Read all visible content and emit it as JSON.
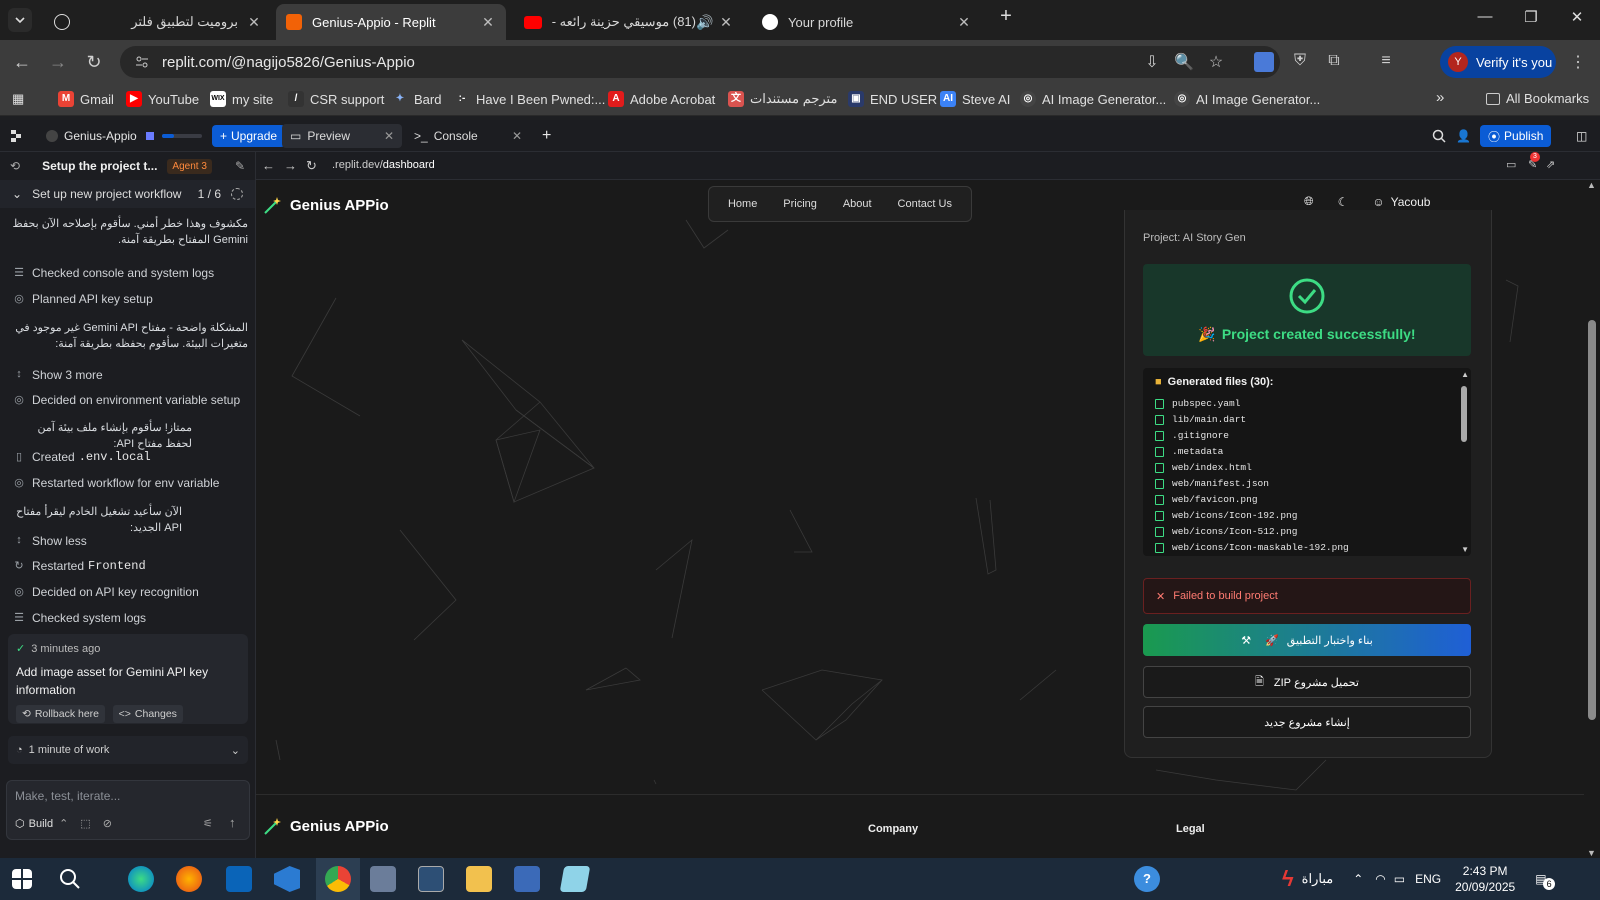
{
  "browser": {
    "tabs": [
      {
        "title": "بروميت لتطبيق فلتر",
        "icon": "openai-icon"
      },
      {
        "title": "Genius-Appio - Replit",
        "icon": "replit-icon"
      },
      {
        "title": "(81) موسيقي حزينة رائعه - e",
        "icon": "youtube-icon"
      },
      {
        "title": "Your profile",
        "icon": "github-icon"
      }
    ],
    "new_tab": "+",
    "url": "replit.com/@nagijo5826/Genius-Appio",
    "verify_label": "Verify it's you",
    "verify_avatar": "Y",
    "window_controls": [
      "—",
      "❐",
      "✕"
    ]
  },
  "bookmarks": {
    "items": [
      "Gmail",
      "YouTube",
      "my site",
      "CSR support",
      "Bard",
      "Have I Been Pwned:...",
      "Adobe Acrobat",
      "مترجم مستندات",
      "END USER",
      "Steve AI",
      "AI Image Generator...",
      "AI Image Generator..."
    ],
    "overflow": "»",
    "all": "All Bookmarks"
  },
  "replit": {
    "project_name": "Genius-Appio",
    "upgrade": "Upgrade",
    "tabs": [
      "Preview",
      "Console"
    ],
    "publish": "Publish"
  },
  "agent": {
    "title": "Setup the project t...",
    "badge": "Agent 3",
    "workflow": "Set up new project workflow",
    "progress": "1 / 6",
    "feed": [
      {
        "type": "ar",
        "text": "مكشوف وهذا خطر أمني. سأقوم بإصلاحه الآن بحفظ Gemini المفتاح بطريقة آمنة."
      },
      {
        "type": "item",
        "text": "Checked console and system logs"
      },
      {
        "type": "item",
        "text": "Planned API key setup"
      },
      {
        "type": "ar",
        "text": "المشكلة واضحة - مفتاح Gemini API غير موجود في متغيرات البيئة. سأقوم بحفظه بطريقة آمنة:"
      },
      {
        "type": "item",
        "text": "Show 3 more"
      },
      {
        "type": "item",
        "text": "Decided on environment variable setup"
      },
      {
        "type": "ar",
        "text": "ممتاز! سأقوم بإنشاء ملف بيئة آمن لحفظ مفتاح API:"
      },
      {
        "type": "item",
        "text": "Created",
        "code": ".env.local"
      },
      {
        "type": "item",
        "text": "Restarted workflow for env variable"
      },
      {
        "type": "ar",
        "text": "الآن سأعيد تشغيل الخادم ليقرأ مفتاح API الجديد:"
      },
      {
        "type": "item",
        "text": "Show less"
      },
      {
        "type": "item",
        "text": "Restarted",
        "code": "Frontend"
      },
      {
        "type": "item",
        "text": "Decided on API key recognition"
      },
      {
        "type": "item",
        "text": "Checked system logs"
      }
    ],
    "card": {
      "time": "3 minutes ago",
      "message": "Add image asset for Gemini API key information",
      "rollback": "Rollback here",
      "changes": "Changes"
    },
    "work": "1 minute of work",
    "input_placeholder": "Make, test, iterate...",
    "build": "Build"
  },
  "preview": {
    "url_prefix": ".replit.dev/",
    "url_path": "dashboard",
    "brand": "Genius APPio",
    "nav": [
      "Home",
      "Pricing",
      "About",
      "Contact Us"
    ],
    "user": "Yacoub",
    "project_label": "Project: AI Story Gen",
    "success": "Project created successfully!",
    "success_emoji": "🎉",
    "files_header": "Generated files (30):",
    "files": [
      "pubspec.yaml",
      "lib/main.dart",
      ".gitignore",
      ".metadata",
      "web/index.html",
      "web/manifest.json",
      "web/favicon.png",
      "web/icons/Icon-192.png",
      "web/icons/Icon-512.png",
      "web/icons/Icon-maskable-192.png"
    ],
    "error": "Failed to build project",
    "buttons": [
      "بناء واختبار التطبيق",
      "تحميل مشروع ZIP",
      "إنشاء مشروع جديد"
    ],
    "footer": {
      "brand": "Genius APPio",
      "col1": "Company",
      "col2": "Legal"
    }
  },
  "taskbar": {
    "weather": "مباراة",
    "lang": "ENG",
    "time": "2:43 PM",
    "date": "20/09/2025",
    "notif_count": "6"
  },
  "colors": {
    "accent": "#0b5cd5",
    "success": "#3ddc84",
    "error": "#ff7b72"
  }
}
